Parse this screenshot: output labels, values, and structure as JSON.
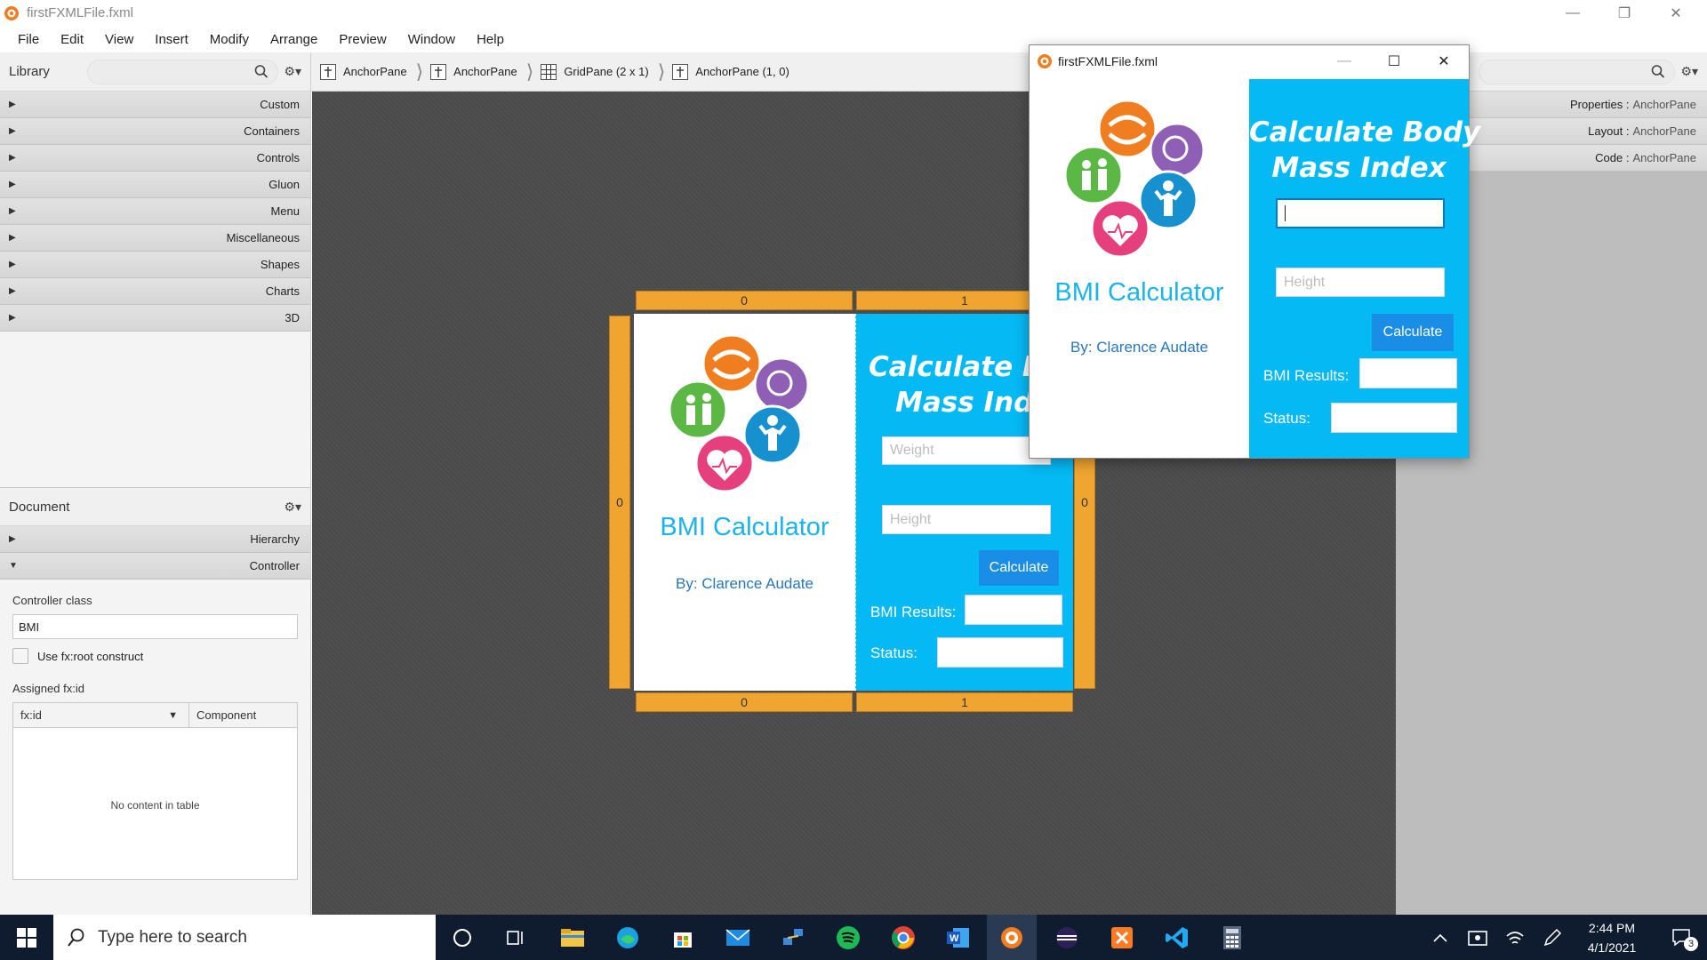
{
  "window": {
    "title": "firstFXMLFile.fxml"
  },
  "menu": [
    "File",
    "Edit",
    "View",
    "Insert",
    "Modify",
    "Arrange",
    "Preview",
    "Window",
    "Help"
  ],
  "library": {
    "title": "Library",
    "sections": [
      "Custom",
      "Containers",
      "Controls",
      "Gluon",
      "Menu",
      "Miscellaneous",
      "Shapes",
      "Charts",
      "3D"
    ]
  },
  "document": {
    "title": "Document",
    "sections": [
      "Hierarchy",
      "Controller"
    ],
    "controller_class_label": "Controller class",
    "controller_class_value": "BMI",
    "use_root_label": "Use fx:root construct",
    "assigned_label": "Assigned fx:id",
    "table_headers": [
      "fx:id",
      "Component"
    ],
    "table_empty": "No content in table"
  },
  "breadcrumb": [
    "AnchorPane",
    "AnchorPane",
    "GridPane (2 x 1)",
    "AnchorPane (1, 0)"
  ],
  "inspector": [
    {
      "label": "Properties",
      "value": "AnchorPane"
    },
    {
      "label": "Layout",
      "value": "AnchorPane"
    },
    {
      "label": "Code",
      "value": "AnchorPane"
    }
  ],
  "grid_handles": {
    "top_col0": "0",
    "top_col1": "1",
    "bottom_col0": "0",
    "bottom_col1": "1",
    "left_row0": "0",
    "right_row0": "0"
  },
  "bmi": {
    "title": "BMI Calculator",
    "author": "By: Clarence Audate",
    "heading_line1": "Calculate Body",
    "heading_line2": "Mass Index",
    "heading_line1_clipped": "Calculate Bod",
    "heading_line2_clipped": "Mass Index",
    "weight_placeholder": "Weight",
    "height_placeholder": "Height",
    "calculate": "Calculate",
    "results_label": "BMI Results:",
    "status_label": "Status:"
  },
  "preview": {
    "title": "firstFXMLFile.fxml"
  },
  "taskbar": {
    "search_placeholder": "Type here to search",
    "time": "2:44 PM",
    "date": "4/1/2021",
    "notification_count": "3"
  },
  "colors": {
    "accent_orange": "#f0a530",
    "bmi_blue": "#05b9f4",
    "button_blue": "#1a8ee6"
  }
}
